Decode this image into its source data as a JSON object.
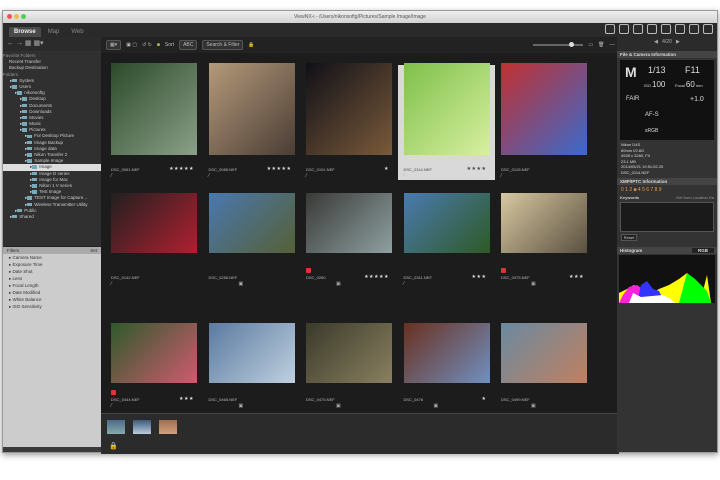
{
  "window": {
    "title": "ViewNX-i - /Users/nikonsoftg/Pictures/Sample Image/Image"
  },
  "tabs": [
    {
      "label": "Browse",
      "active": true
    },
    {
      "label": "Map"
    },
    {
      "label": "Web"
    }
  ],
  "left": {
    "favorites_header": "Favorite Folders",
    "favorites": [
      "Recent Transfer",
      "Backup Destination"
    ],
    "folders_header": "Folders",
    "tree": [
      {
        "label": "System",
        "d": 1
      },
      {
        "label": "Users",
        "d": 1
      },
      {
        "label": "nikonsoftg",
        "d": 2
      },
      {
        "label": "Desktop",
        "d": 3
      },
      {
        "label": "Documents",
        "d": 3
      },
      {
        "label": "Downloads",
        "d": 3
      },
      {
        "label": "Movies",
        "d": 3
      },
      {
        "label": "Music",
        "d": 3
      },
      {
        "label": "Pictures",
        "d": 3
      },
      {
        "label": "For Desktop Picture",
        "d": 4
      },
      {
        "label": "Image Backup",
        "d": 4
      },
      {
        "label": "Image data",
        "d": 4
      },
      {
        "label": "Nikon Transfer 2",
        "d": 4
      },
      {
        "label": "Sample Image",
        "d": 4
      },
      {
        "label": "Image",
        "d": 5,
        "selected": true
      },
      {
        "label": "Image D series",
        "d": 5
      },
      {
        "label": "Image for Mac",
        "d": 5
      },
      {
        "label": "Nikon 1 V series",
        "d": 5
      },
      {
        "label": "Test Image",
        "d": 5
      },
      {
        "label": "TEST Image for Capture…",
        "d": 4
      },
      {
        "label": "Wireless Transmitter Utility",
        "d": 4
      },
      {
        "label": "Public",
        "d": 2
      },
      {
        "label": "Shared",
        "d": 1
      }
    ],
    "filters_header": "Filters",
    "filters_action": "Set",
    "filters": [
      "Camera Name",
      "Exposure Time",
      "Date Shot",
      "Lens",
      "Focal Length",
      "Date Modified",
      "White Balance",
      "ISO Sensitivity"
    ]
  },
  "toolbar": {
    "sort_label": "Sort",
    "sort_value": "ABC",
    "search_filter": "Search & Filter"
  },
  "grid": {
    "selected_index": 3,
    "items": [
      {
        "name": "DSC_0061.NEF",
        "stars": 5,
        "c1": "#2c4a2a",
        "c2": "#8aa088",
        "edit": true
      },
      {
        "name": "DSC_0085.NEF",
        "stars": 5,
        "c1": "#b59a7a",
        "c2": "#4a3d35",
        "edit": true
      },
      {
        "name": "DSC_0101.NEF",
        "stars": 1,
        "c1": "#101018",
        "c2": "#7a5a3a",
        "edit": true
      },
      {
        "name": "DSC_0114.NEF",
        "stars": 4,
        "c1": "#7ec04a",
        "c2": "#d8f0a0",
        "edit": true
      },
      {
        "name": "DSC_0128.NEF",
        "stars": 0,
        "c1": "#c23030",
        "c2": "#3a6acc",
        "edit": true
      },
      {
        "name": "DSC_0142.NEF",
        "stars": 0,
        "c1": "#202020",
        "c2": "#b02030",
        "edit": true
      },
      {
        "name": "DSC_0256.NEF",
        "stars": 0,
        "c1": "#4a78b0",
        "c2": "#556035",
        "box": true
      },
      {
        "name": "DSC_0260",
        "stars": 5,
        "c1": "#3a3a38",
        "c2": "#8ea0a0",
        "box": true,
        "label": true
      },
      {
        "name": "DSC_0311.NEF",
        "stars": 3,
        "c1": "#4a7ab0",
        "c2": "#2e5a25",
        "edit": true
      },
      {
        "name": "DSC_0375.NEF",
        "stars": 3,
        "c1": "#d8c8a0",
        "c2": "#5a5040",
        "box": true,
        "label": true
      },
      {
        "name": "DSC_0444.NEF",
        "stars": 3,
        "c1": "#2e5a2a",
        "c2": "#d05a70",
        "edit": true,
        "label": true
      },
      {
        "name": "DSC_0465.NEF",
        "stars": 0,
        "c1": "#5a7aa0",
        "c2": "#c0d0e0",
        "box": true
      },
      {
        "name": "DSC_0475.NEF",
        "stars": 0,
        "c1": "#3a3a2a",
        "c2": "#8a8060",
        "box": true
      },
      {
        "name": "DSC_0476",
        "stars": 1,
        "c1": "#6a3020",
        "c2": "#7090c0",
        "box": true
      },
      {
        "name": "DSC_0499.NEF",
        "stars": 0,
        "c1": "#6a8aa0",
        "c2": "#c08060",
        "box": true
      }
    ]
  },
  "right": {
    "nav": "4/20",
    "file_info_header": "File & Camera Information",
    "mode": "M",
    "shutter": "1/13",
    "aperture": "F11",
    "iso_label": "ISO",
    "iso": "100",
    "focal_label": "Focal",
    "focal": "60",
    "focal_unit": "mm",
    "wb": "FAIR",
    "exp_comp": "+1.0",
    "af": "AF-S",
    "color": "sRGB",
    "meta": [
      "Nikon D4S",
      "60mm f/2.8G",
      "4928 x 3280, FX",
      "23.1 MB",
      "2014/05/21 19:51:52.25",
      "DSC_0114.NEF"
    ],
    "xmp_header": "XMP/IPTC Information",
    "keywords_label": "Keywords",
    "keywords_action": "Get from Location Da",
    "reset": "Reset",
    "histogram_header": "Histogram",
    "histogram_mode": "RGB"
  }
}
